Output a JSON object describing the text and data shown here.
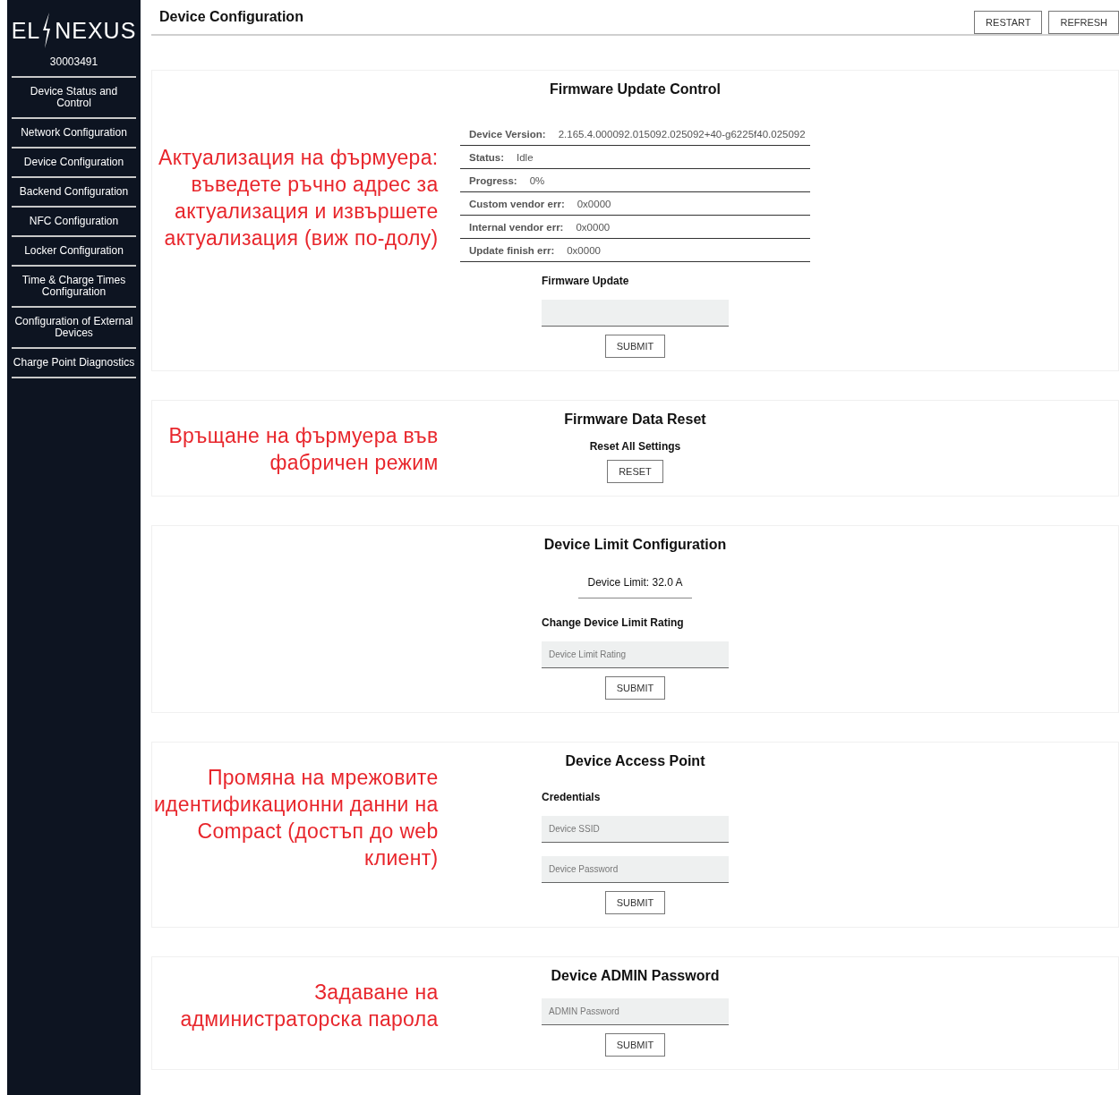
{
  "sidebar": {
    "logo": {
      "left": "EL",
      "right": "NEXUS"
    },
    "serial": "30003491",
    "items": [
      {
        "label": "Device Status and Control"
      },
      {
        "label": "Network Configuration"
      },
      {
        "label": "Device Configuration"
      },
      {
        "label": "Backend Configuration"
      },
      {
        "label": "NFC Configuration"
      },
      {
        "label": "Locker Configuration"
      },
      {
        "label": "Time & Charge Times Configuration"
      },
      {
        "label": "Configuration of External Devices"
      },
      {
        "label": "Charge Point Diagnostics"
      }
    ]
  },
  "header": {
    "title": "Device Configuration",
    "buttons": [
      "RESTART",
      "REFRESH"
    ]
  },
  "sections": [
    {
      "title": "Firmware Update Control",
      "note": "Актуализация на фърмуера: въведете ръчно адрес за актуализация и извършете актуализация (виж по-долу)",
      "items": [
        {
          "kind": "info_table",
          "rows": [
            {
              "label": "Device Version:",
              "value": "2.165.4.000092.015092.025092+40-g6225f40.025092"
            },
            {
              "label": "Status:",
              "value": "Idle"
            },
            {
              "label": "Progress:",
              "value": "0%"
            },
            {
              "label": "Custom vendor err:",
              "value": "0x0000"
            },
            {
              "label": "Internal vendor err:",
              "value": "0x0000"
            },
            {
              "label": "Update finish err:",
              "value": "0x0000"
            }
          ]
        },
        {
          "kind": "subheading",
          "text": "Firmware Update"
        },
        {
          "kind": "field"
        },
        {
          "kind": "button",
          "text": "SUBMIT"
        }
      ]
    },
    {
      "title": "Firmware Data Reset",
      "note": "Връщане на фърмуера във фабричен режим",
      "items": [
        {
          "kind": "subheading",
          "text": "Reset All Settings",
          "centered": true
        },
        {
          "kind": "button",
          "text": "RESET"
        }
      ]
    },
    {
      "title": "Device Limit Configuration",
      "items": [
        {
          "kind": "reading",
          "text": "Device Limit: 32.0 A"
        },
        {
          "kind": "subheading",
          "text": "Change Device Limit Rating"
        },
        {
          "kind": "field",
          "placeholder": "Device Limit Rating"
        },
        {
          "kind": "button",
          "text": "SUBMIT"
        }
      ]
    },
    {
      "title": "Device Access Point",
      "note": "Промяна на мрежовите идентификационни данни на Compact (достъп до web клиент)",
      "items": [
        {
          "kind": "subheading",
          "text": "Credentials"
        },
        {
          "kind": "field",
          "placeholder": "Device SSID"
        },
        {
          "kind": "field",
          "placeholder": "Device Password"
        },
        {
          "kind": "button",
          "text": "SUBMIT"
        }
      ]
    },
    {
      "title": "Device ADMIN Password",
      "note": "Задаване на администраторска парола",
      "items": [
        {
          "kind": "field",
          "placeholder": "ADMIN Password"
        },
        {
          "kind": "button",
          "text": "SUBMIT"
        }
      ]
    }
  ]
}
